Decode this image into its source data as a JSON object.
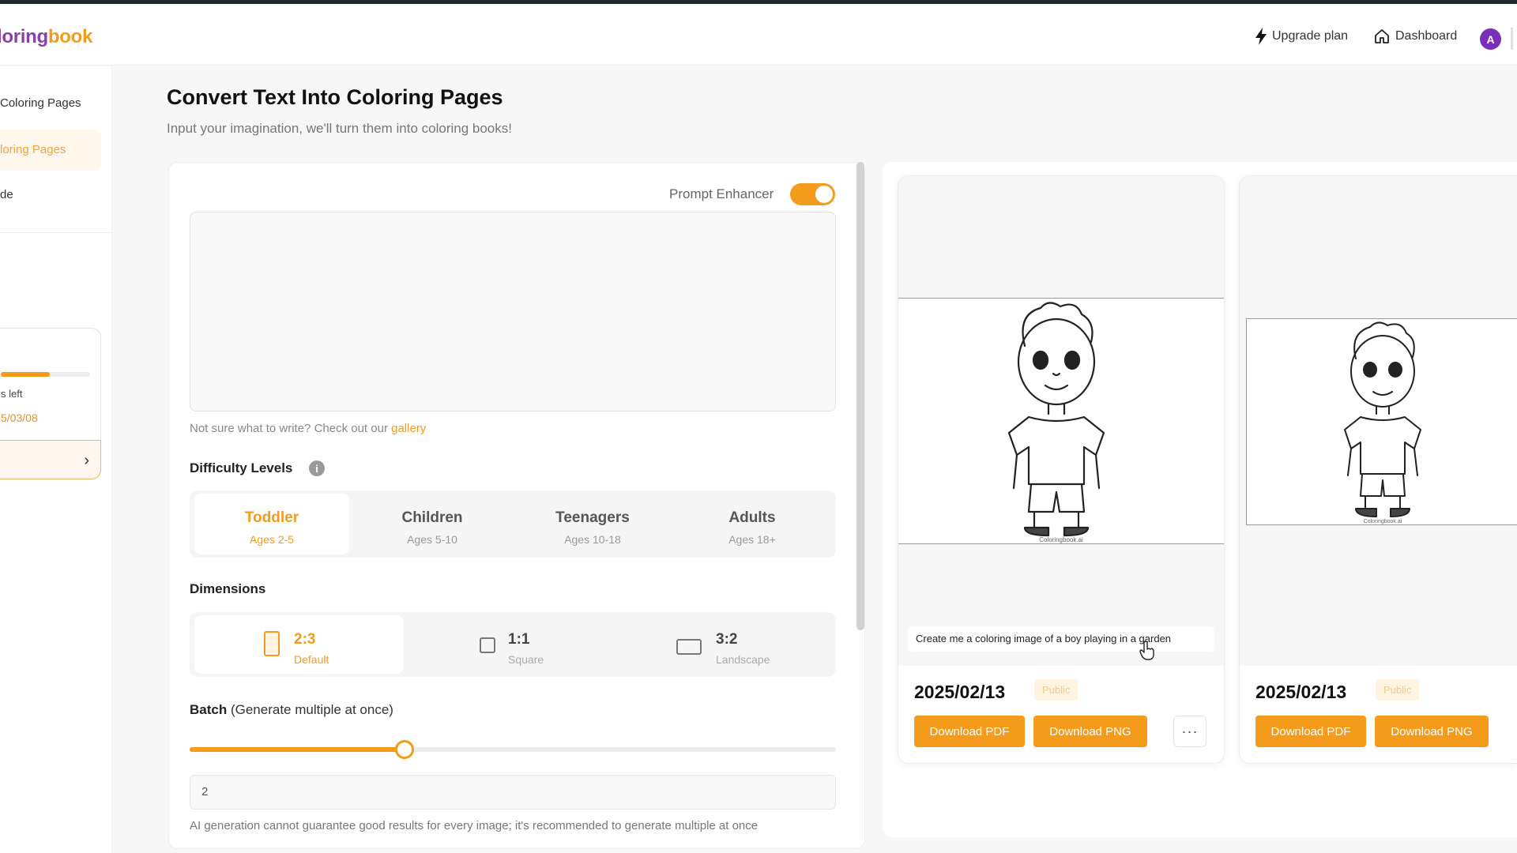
{
  "header": {
    "logo_part1": "loring",
    "logo_part2": "book",
    "upgrade_label": "Upgrade plan",
    "dashboard_label": "Dashboard",
    "avatar_letter": "A"
  },
  "sidebar": {
    "items": [
      {
        "label": "Coloring Pages"
      },
      {
        "label": "loring Pages"
      },
      {
        "label": "de"
      }
    ],
    "usage": {
      "progress_fraction": 0.55,
      "left_text": "s left",
      "date_text": "5/03/08"
    }
  },
  "main": {
    "title": "Convert Text Into Coloring Pages",
    "subtitle": "Input your imagination, we'll turn them into coloring books!",
    "prompt_enhancer_label": "Prompt Enhancer",
    "prompt_enhancer_on": true,
    "prompt_value": "",
    "hint_text": "Not sure what to write? Check out our",
    "hint_link": "gallery",
    "difficulty_label": "Difficulty Levels",
    "info_symbol": "i",
    "levels": [
      {
        "name": "Toddler",
        "ages": "Ages 2-5",
        "active": true
      },
      {
        "name": "Children",
        "ages": "Ages 5-10",
        "active": false
      },
      {
        "name": "Teenagers",
        "ages": "Ages 10-18",
        "active": false
      },
      {
        "name": "Adults",
        "ages": "Ages 18+",
        "active": false
      }
    ],
    "dimensions_label": "Dimensions",
    "dimensions": [
      {
        "ratio": "2:3",
        "sub": "Default",
        "active": true
      },
      {
        "ratio": "1:1",
        "sub": "Square",
        "active": false
      },
      {
        "ratio": "3:2",
        "sub": "Landscape",
        "active": false
      }
    ],
    "batch_label": "Batch",
    "batch_desc": "(Generate multiple at once)",
    "batch_slider_fraction": 0.333,
    "batch_value": "2",
    "warning": "AI generation cannot guarantee good results for every image; it's recommended to generate multiple at once"
  },
  "results": {
    "cards": [
      {
        "prompt": "Create me a coloring image of a boy playing in a garden",
        "date": "2025/02/13",
        "badge": "Public",
        "download_pdf": "Download PDF",
        "download_png": "Download PNG",
        "more": "···",
        "watermark": "Coloringbook.ai"
      },
      {
        "prompt": "",
        "date": "2025/02/13",
        "badge": "Public",
        "download_pdf": "Download PDF",
        "download_png": "Download PNG",
        "watermark": "Coloringbook.ai"
      }
    ]
  },
  "colors": {
    "accent": "#f59b1b",
    "brand_purple": "#8a3fa8",
    "avatar": "#7b2fb8"
  }
}
